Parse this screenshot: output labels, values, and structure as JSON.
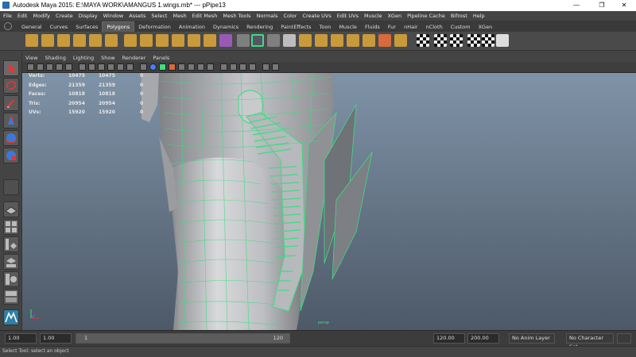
{
  "window": {
    "title": "Autodesk Maya 2015: E:\\MAYA WORK\\AMANGUS 1.wings.mb*   ---   pPipe13"
  },
  "menubar": [
    "File",
    "Edit",
    "Modify",
    "Create",
    "Display",
    "Window",
    "Assets",
    "Select",
    "Mesh",
    "Edit Mesh",
    "Mesh Tools",
    "Normals",
    "Color",
    "Create UVs",
    "Edit UVs",
    "Muscle",
    "XGen",
    "Pipeline Cache",
    "Bifrost",
    "Help"
  ],
  "shelf_tabs": [
    "General",
    "Curves",
    "Surfaces",
    "Polygons",
    "Deformation",
    "Animation",
    "Dynamics",
    "Rendering",
    "PaintEffects",
    "Toon",
    "Muscle",
    "Fluids",
    "Fur",
    "nHair",
    "nCloth",
    "Custom",
    "XGen"
  ],
  "active_shelf_tab": "Polygons",
  "panel_menu": [
    "View",
    "Shading",
    "Lighting",
    "Show",
    "Renderer",
    "Panels"
  ],
  "hud": {
    "rows": [
      {
        "label": "Verts:",
        "v1": "10475",
        "v2": "10475",
        "v3": "0"
      },
      {
        "label": "Edges:",
        "v1": "21359",
        "v2": "21359",
        "v3": "0"
      },
      {
        "label": "Faces:",
        "v1": "10818",
        "v2": "10818",
        "v3": "0"
      },
      {
        "label": "Tris:",
        "v1": "20954",
        "v2": "20954",
        "v3": "0"
      },
      {
        "label": "UVs:",
        "v1": "15920",
        "v2": "15920",
        "v3": "0"
      }
    ]
  },
  "camera_label": "persp",
  "range": {
    "start": "1.00",
    "playback_start": "1.00",
    "slider_current": "1",
    "slider_end": "120",
    "playback_end": "120.00",
    "end": "200.00",
    "anim_layer": "No Anim Layer",
    "character_set": "No Character Set"
  },
  "status": "Select Tool: select an object",
  "colors": {
    "wire": "#3ddc84",
    "mesh": "#c9cacc",
    "viewport_top": "#7f93a8",
    "viewport_bottom": "#4d5967"
  }
}
